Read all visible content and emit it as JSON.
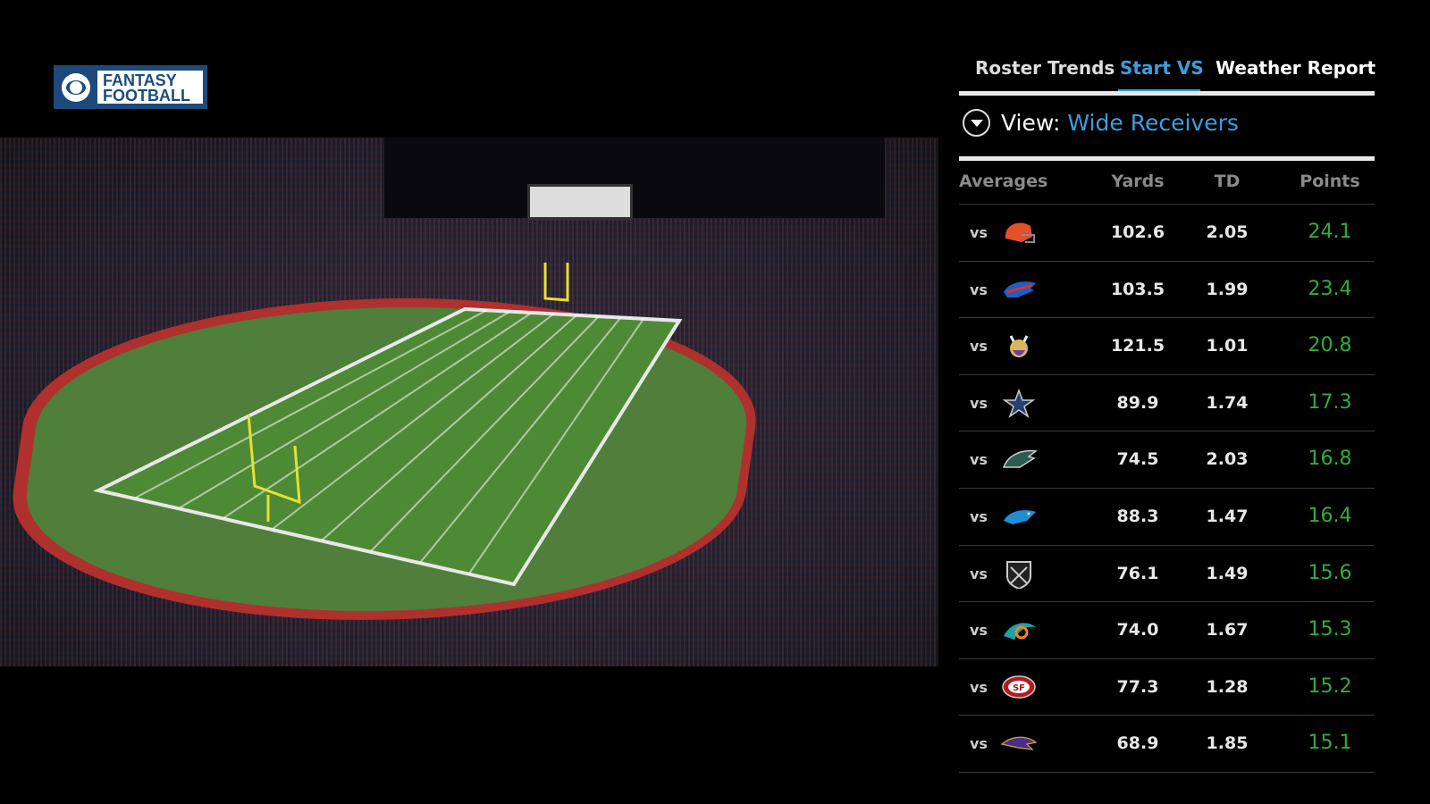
{
  "brand": {
    "logo_text": "FANTASY FOOTBALL",
    "logo_line1": "FANTASY",
    "logo_line2": "FOOTBALL",
    "color": "#1d4a7a"
  },
  "tabs": [
    {
      "label": "Roster Trends",
      "active": false
    },
    {
      "label": "Start VS",
      "active": true
    },
    {
      "label": "Weather Report",
      "active": false
    }
  ],
  "view": {
    "label": "View:",
    "value": "Wide Receivers",
    "icon": "chevron-down-circle-icon"
  },
  "table": {
    "headers": [
      "Averages",
      "Yards",
      "TD",
      "Points"
    ],
    "rows": [
      {
        "vs": "vs",
        "team": "browns",
        "yards": "102.6",
        "td": "2.05",
        "points": "24.1"
      },
      {
        "vs": "vs",
        "team": "bills",
        "yards": "103.5",
        "td": "1.99",
        "points": "23.4"
      },
      {
        "vs": "vs",
        "team": "vikings",
        "yards": "121.5",
        "td": "1.01",
        "points": "20.8"
      },
      {
        "vs": "vs",
        "team": "cowboys",
        "yards": "89.9",
        "td": "1.74",
        "points": "17.3"
      },
      {
        "vs": "vs",
        "team": "eagles",
        "yards": "74.5",
        "td": "2.03",
        "points": "16.8"
      },
      {
        "vs": "vs",
        "team": "panthers",
        "yards": "88.3",
        "td": "1.47",
        "points": "16.4"
      },
      {
        "vs": "vs",
        "team": "raiders",
        "yards": "76.1",
        "td": "1.49",
        "points": "15.6"
      },
      {
        "vs": "vs",
        "team": "dolphins",
        "yards": "74.0",
        "td": "1.67",
        "points": "15.3"
      },
      {
        "vs": "vs",
        "team": "49ers",
        "yards": "77.3",
        "td": "1.28",
        "points": "15.2"
      },
      {
        "vs": "vs",
        "team": "ravens",
        "yards": "68.9",
        "td": "1.85",
        "points": "15.1"
      }
    ]
  },
  "colors": {
    "accent": "#3a9ee0",
    "points": "#2fae3a"
  }
}
